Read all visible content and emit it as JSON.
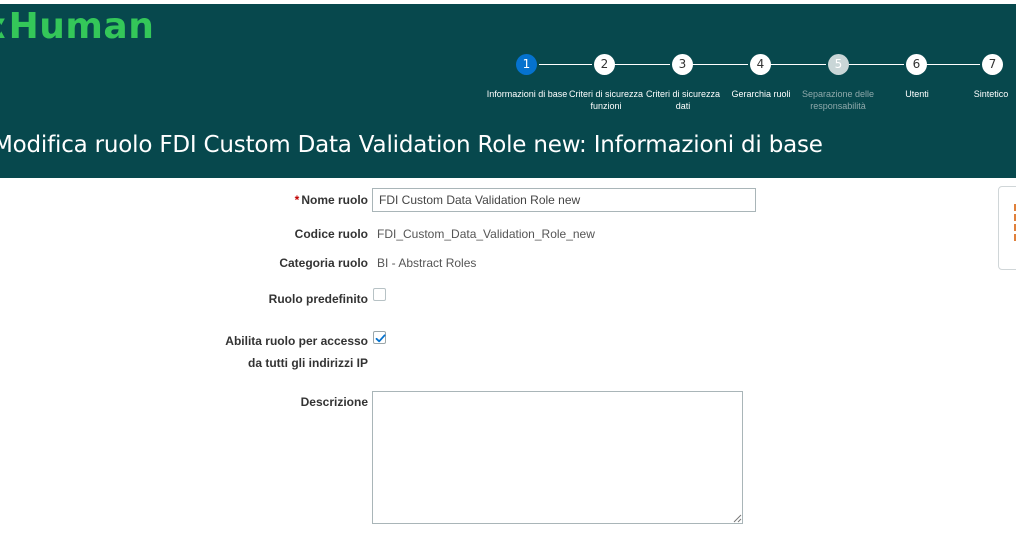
{
  "app": {
    "logo_text": "ːHuman"
  },
  "train": {
    "steps": [
      {
        "number": "1",
        "label": "Informazioni di base",
        "state": "current"
      },
      {
        "number": "2",
        "label": "Criteri di sicurezza funzioni",
        "state": "enabled"
      },
      {
        "number": "3",
        "label": "Criteri di sicurezza dati",
        "state": "enabled"
      },
      {
        "number": "4",
        "label": "Gerarchia ruoli",
        "state": "enabled"
      },
      {
        "number": "5",
        "label": "Separazione delle responsabilità",
        "state": "disabled"
      },
      {
        "number": "6",
        "label": "Utenti",
        "state": "enabled"
      },
      {
        "number": "7",
        "label": "Sintetico",
        "state": "enabled"
      }
    ]
  },
  "page": {
    "title": "Modifica ruolo FDI Custom Data Validation Role new: Informazioni di base"
  },
  "form": {
    "required_marker": "*",
    "role_name_label": "Nome ruolo",
    "role_name_value": "FDI Custom Data Validation Role new",
    "role_code_label": "Codice ruolo",
    "role_code_value": "FDI_Custom_Data_Validation_Role_new",
    "role_category_label": "Categoria ruolo",
    "role_category_value": "BI - Abstract Roles",
    "predefined_label": "Ruolo predefinito",
    "predefined_checked": false,
    "ip_access_label_line1": "Abilita ruolo per accesso",
    "ip_access_label_line2": "da tutti gli indirizzi IP",
    "ip_access_checked": true,
    "description_label": "Descrizione",
    "description_value": ""
  },
  "colors": {
    "header_bg": "#07484d",
    "logo": "#34c759",
    "current_step": "#0572ce",
    "accent_orange": "#e0803a"
  }
}
